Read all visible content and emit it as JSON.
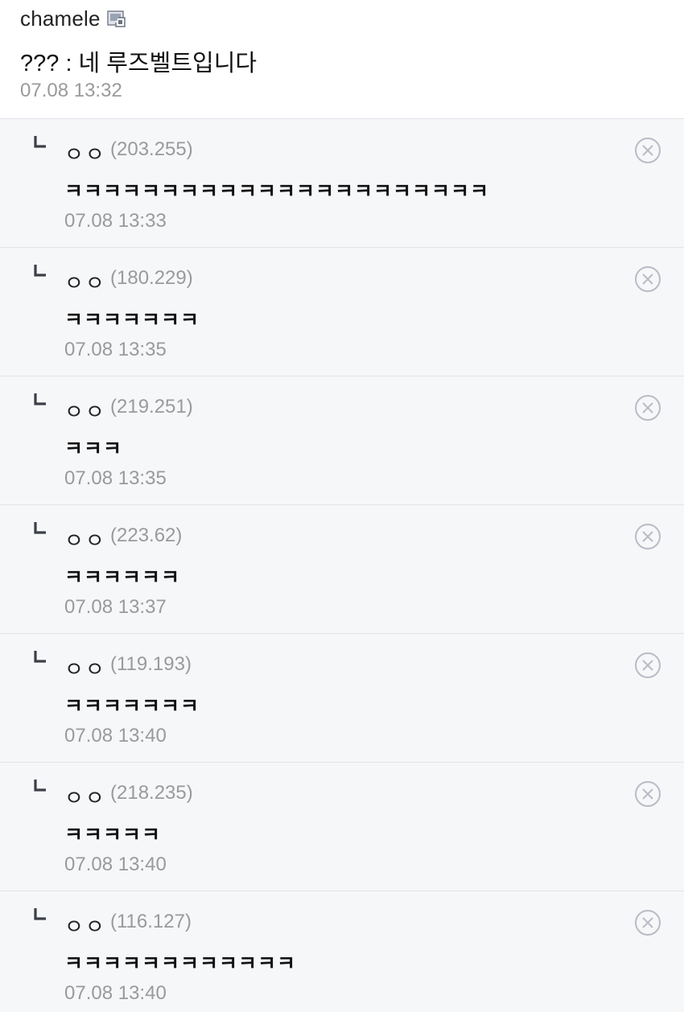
{
  "main_comment": {
    "author": "chamele",
    "author_icon": "fixed-member-icon",
    "text": "??? : 네 루즈벨트입니다",
    "time": "07.08 13:32"
  },
  "replies": [
    {
      "nick": "ㅇㅇ",
      "ip": "(203.255)",
      "text": "ㅋㅋㅋㅋㅋㅋㅋㅋㅋㅋㅋㅋㅋㅋㅋㅋㅋㅋㅋㅋㅋㅋ",
      "time": "07.08 13:33"
    },
    {
      "nick": "ㅇㅇ",
      "ip": "(180.229)",
      "text": "ㅋㅋㅋㅋㅋㅋㅋ",
      "time": "07.08 13:35"
    },
    {
      "nick": "ㅇㅇ",
      "ip": "(219.251)",
      "text": "ㅋㅋㅋ",
      "time": "07.08 13:35"
    },
    {
      "nick": "ㅇㅇ",
      "ip": "(223.62)",
      "text": "ㅋㅋㅋㅋㅋㅋ",
      "time": "07.08 13:37"
    },
    {
      "nick": "ㅇㅇ",
      "ip": "(119.193)",
      "text": "ㅋㅋㅋㅋㅋㅋㅋ",
      "time": "07.08 13:40"
    },
    {
      "nick": "ㅇㅇ",
      "ip": "(218.235)",
      "text": "ㅋㅋㅋㅋㅋ",
      "time": "07.08 13:40"
    },
    {
      "nick": "ㅇㅇ",
      "ip": "(116.127)",
      "text": "ㅋㅋㅋㅋㅋㅋㅋㅋㅋㅋㅋㅋ",
      "time": "07.08 13:40"
    }
  ],
  "icons": {
    "reply_marker": "reply-corner-icon",
    "delete": "close-circle-icon"
  },
  "colors": {
    "reply_background": "#f6f7f9",
    "meta_text": "#9a9a9a",
    "divider": "#e3e4e8"
  }
}
